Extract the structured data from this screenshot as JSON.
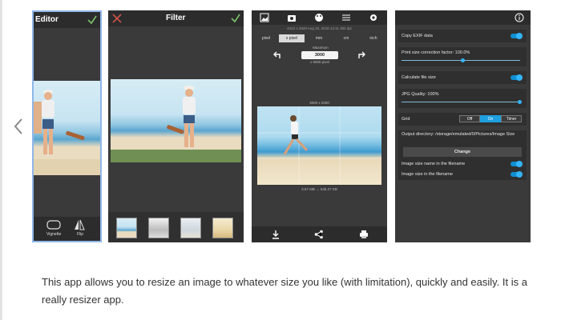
{
  "screens": {
    "editor": {
      "title": "Editor",
      "tools": [
        "Vignette",
        "Flip"
      ]
    },
    "filter": {
      "title": "Filter"
    },
    "resize": {
      "info": "4242 x 2828  Aug 20, 2018 13:11  300 dpi",
      "units": [
        "pixel",
        "x pixel",
        "mm",
        "cm",
        "inch"
      ],
      "selected_unit": "x pixel",
      "maximum_label": "Maximum",
      "width_value": "3000",
      "max_note": "x 5000 pixel",
      "image_size": "3000 x 2000",
      "file_size": "3.67 MB → 545.27 KB"
    },
    "settings": {
      "copy_exif": "Copy EXIF data",
      "print_size": "Print size correction factor: 100.0%",
      "calc_file_size": "Calculate file size",
      "jpg_quality": "JPG Quality: 100%",
      "grid_label": "Grid",
      "grid_options": [
        "Off",
        "On",
        "Timer"
      ],
      "grid_selected": "On",
      "output_dir": "Output directory: /storage/emulated/0/Pictures/Image Size",
      "change_button": "Change",
      "name_in_file": "Image size name in the filename",
      "size_in_file": "Image size in the filename"
    }
  },
  "description": "This app allows you to resize an image to whatever size you like (with limitation), quickly and easily. It is a really resizer app."
}
